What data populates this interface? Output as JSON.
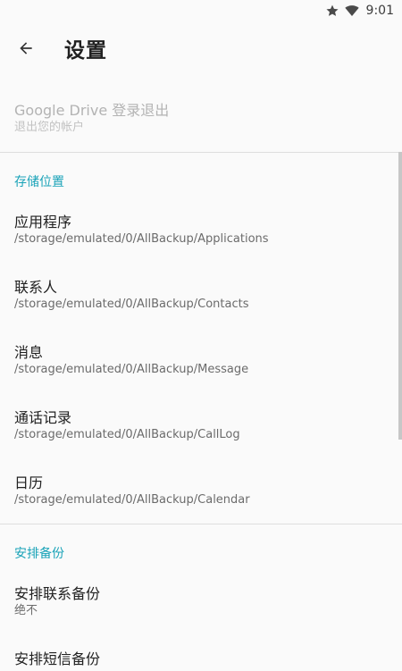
{
  "status_bar": {
    "time": "9:01",
    "icons": [
      "star-icon",
      "wifi-icon"
    ]
  },
  "app_bar": {
    "back_icon": "back-arrow-icon",
    "title": "设置"
  },
  "account": {
    "title": "Google Drive 登录退出",
    "summary": "退出您的帐户",
    "enabled": false
  },
  "storage": {
    "header": "存储位置",
    "items": [
      {
        "title": "应用程序",
        "summary": "/storage/emulated/0/AllBackup/Applications"
      },
      {
        "title": "联系人",
        "summary": "/storage/emulated/0/AllBackup/Contacts"
      },
      {
        "title": "消息",
        "summary": "/storage/emulated/0/AllBackup/Message"
      },
      {
        "title": "通话记录",
        "summary": "/storage/emulated/0/AllBackup/CallLog"
      },
      {
        "title": "日历",
        "summary": "/storage/emulated/0/AllBackup/Calendar"
      }
    ]
  },
  "schedule": {
    "header": "安排备份",
    "items": [
      {
        "title": "安排联系备份",
        "summary": "绝不"
      },
      {
        "title": "安排短信备份",
        "summary": ""
      }
    ]
  },
  "colors": {
    "accent": "#1aa3b8",
    "background": "#fafafa",
    "primary_text": "#212121",
    "secondary_text": "#6b6b6b",
    "divider": "#dedede"
  }
}
